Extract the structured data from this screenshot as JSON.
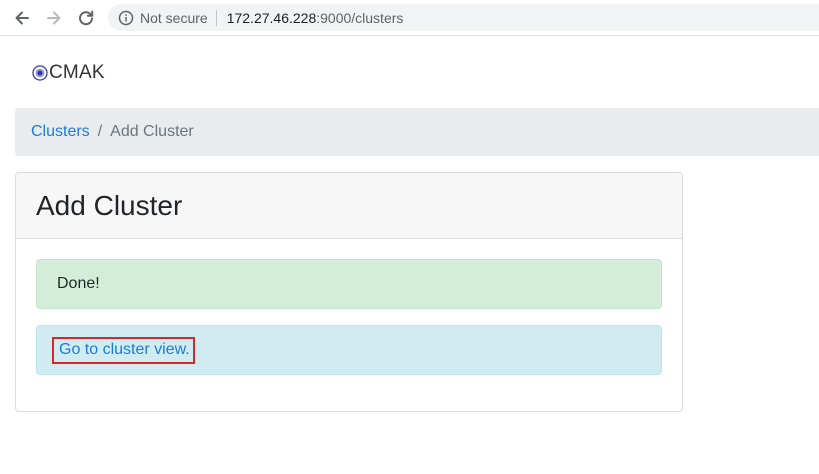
{
  "browser": {
    "security_label": "Not secure",
    "url_host": "172.27.46.228",
    "url_path": ":9000/clusters",
    "icons": {
      "back": "arrow-left-icon",
      "forward": "arrow-right-icon",
      "reload": "reload-icon",
      "info": "info-icon"
    }
  },
  "app": {
    "brand": "CMAK",
    "brand_icon": "cmak-logo-icon"
  },
  "breadcrumb": {
    "link_label": "Clusters",
    "separator": "/",
    "current_label": "Add Cluster"
  },
  "card": {
    "title": "Add Cluster",
    "success_message": "Done!",
    "link_label": "Go to cluster view."
  },
  "colors": {
    "link": "#1a7cd9",
    "success_bg": "#d4edda",
    "info_bg": "#d1ecf1",
    "breadcrumb_bg": "#e9ecef",
    "highlight": "#d62728"
  }
}
